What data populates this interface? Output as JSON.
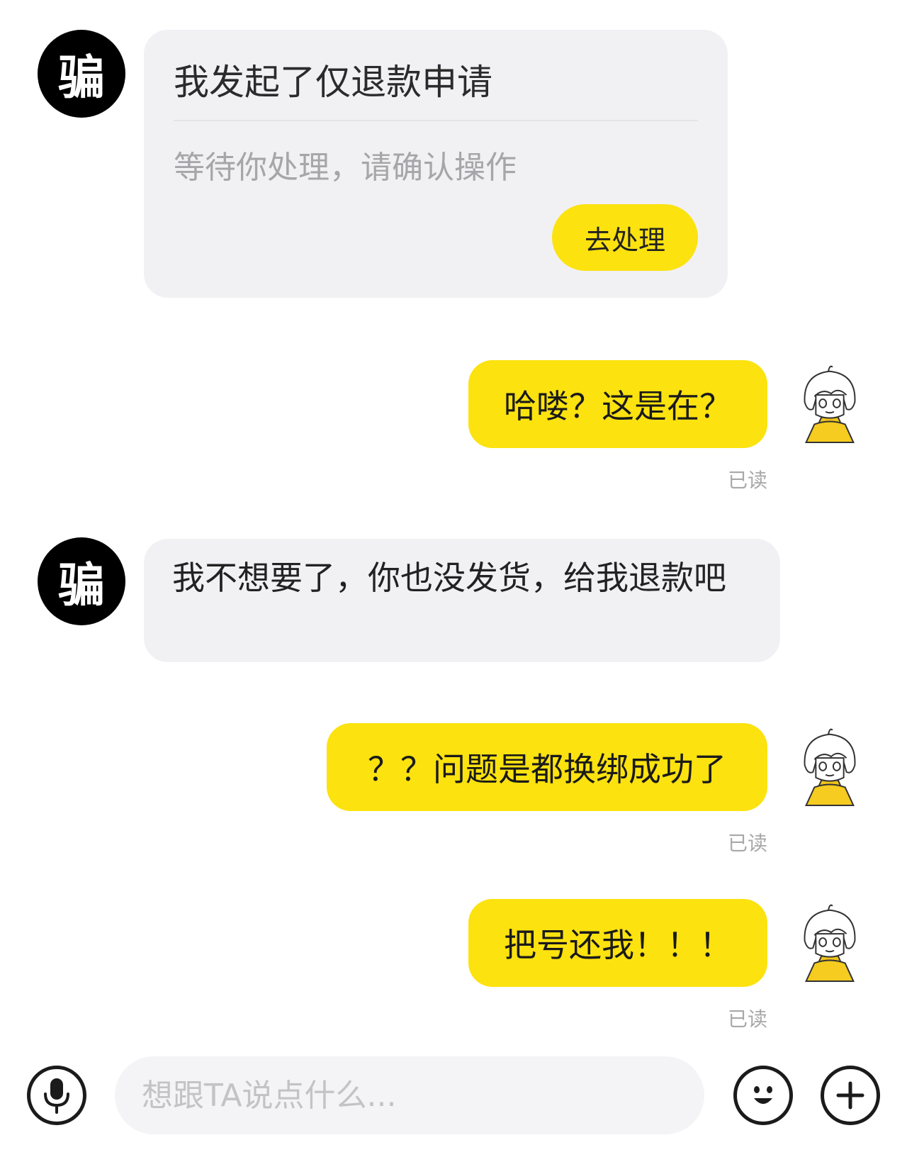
{
  "contact": {
    "avatar_glyph": "骗"
  },
  "messages": {
    "refund_card": {
      "title": "我发起了仅退款申请",
      "subtitle": "等待你处理，请确认操作",
      "action_label": "去处理"
    },
    "out_1": {
      "text": "哈喽？这是在？",
      "status": "已读"
    },
    "in_2": {
      "text": "我不想要了，你也没发货，给我退款吧"
    },
    "out_3": {
      "text": "？？问题是都换绑成功了",
      "status": "已读"
    },
    "out_4": {
      "text": "把号还我！！！",
      "status": "已读"
    }
  },
  "composer": {
    "placeholder": "想跟TA说点什么...",
    "icons": [
      "microphone-icon",
      "emoji-icon",
      "plus-icon"
    ]
  },
  "colors": {
    "accent_yellow": "#fce20f",
    "incoming_bubble": "#f1f1f4",
    "avatar_black": "#000000"
  }
}
